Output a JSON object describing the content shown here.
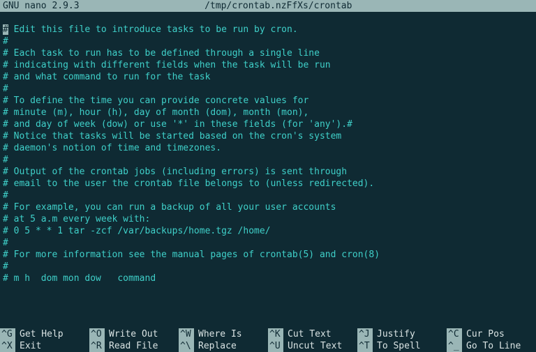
{
  "titlebar": {
    "app": "GNU nano 2.9.3",
    "path": "/tmp/crontab.nzFfXs/crontab"
  },
  "file_lines": [
    "# Edit this file to introduce tasks to be run by cron.",
    "#",
    "# Each task to run has to be defined through a single line",
    "# indicating with different fields when the task will be run",
    "# and what command to run for the task",
    "#",
    "# To define the time you can provide concrete values for",
    "# minute (m), hour (h), day of month (dom), month (mon),",
    "# and day of week (dow) or use '*' in these fields (for 'any').#",
    "# Notice that tasks will be started based on the cron's system",
    "# daemon's notion of time and timezones.",
    "#",
    "# Output of the crontab jobs (including errors) is sent through",
    "# email to the user the crontab file belongs to (unless redirected).",
    "#",
    "# For example, you can run a backup of all your user accounts",
    "# at 5 a.m every week with:",
    "# 0 5 * * 1 tar -zcf /var/backups/home.tgz /home/",
    "#",
    "# For more information see the manual pages of crontab(5) and cron(8)",
    "#",
    "# m h  dom mon dow   command"
  ],
  "cursor": {
    "line": 0,
    "col": 0
  },
  "help": {
    "row1": [
      {
        "key": "^G",
        "label": "Get Help"
      },
      {
        "key": "^O",
        "label": "Write Out"
      },
      {
        "key": "^W",
        "label": "Where Is"
      },
      {
        "key": "^K",
        "label": "Cut Text"
      },
      {
        "key": "^J",
        "label": "Justify"
      },
      {
        "key": "^C",
        "label": "Cur Pos"
      }
    ],
    "row2": [
      {
        "key": "^X",
        "label": "Exit"
      },
      {
        "key": "^R",
        "label": "Read File"
      },
      {
        "key": "^\\",
        "label": "Replace"
      },
      {
        "key": "^U",
        "label": "Uncut Text"
      },
      {
        "key": "^T",
        "label": "To Spell"
      },
      {
        "key": "^_",
        "label": "Go To Line"
      }
    ]
  }
}
